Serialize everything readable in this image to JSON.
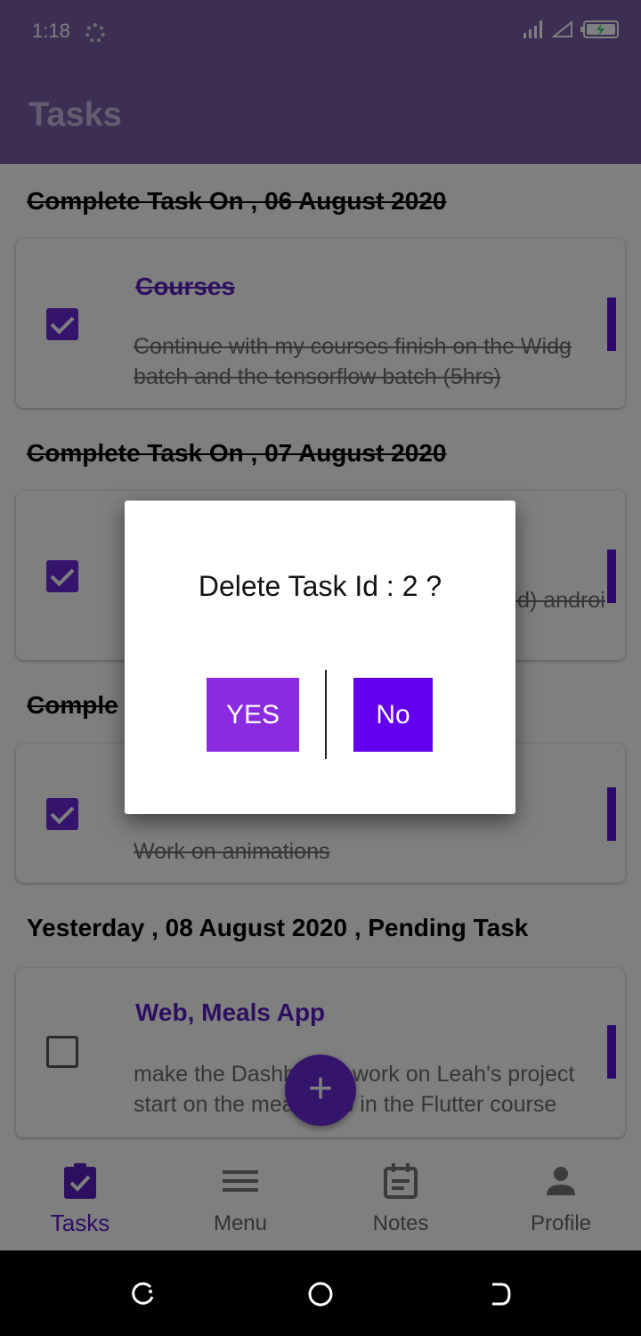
{
  "status_bar": {
    "time": "1:18"
  },
  "app_bar": {
    "title": "Tasks"
  },
  "sections": [
    {
      "title": "Complete Task On , 06 August 2020",
      "strike": true
    },
    {
      "title": "Complete Task On , 07 August 2020",
      "strike": true
    },
    {
      "title": "Comple",
      "strike": true
    },
    {
      "title": "Yesterday , 08 August 2020 , Pending Task",
      "strike": false
    }
  ],
  "tasks": [
    {
      "title": "Courses",
      "desc_line1": "Continue with my courses finish on the Widg",
      "desc_line2": "batch and the tensorflow batch (5hrs)",
      "checked": true
    },
    {
      "title": "",
      "desc_line1": "ild) androi",
      "desc_line2": "",
      "checked": true
    },
    {
      "title": "",
      "desc_line1": "",
      "desc_line2": "Work on animations",
      "checked": true
    },
    {
      "title": "Web, Meals App",
      "desc_line1": "make the Dashboard, work on Leah's project",
      "desc_line2": "start on the meals app in the Flutter course",
      "checked": false
    }
  ],
  "fab": {
    "label": "+"
  },
  "dialog": {
    "message": "Delete Task Id : 2 ?",
    "yes_label": "YES",
    "no_label": "No"
  },
  "bottom_nav": [
    {
      "label": "Tasks",
      "icon": "clipboard-check-icon",
      "active": true
    },
    {
      "label": "Menu",
      "icon": "menu-icon",
      "active": false
    },
    {
      "label": "Notes",
      "icon": "calendar-note-icon",
      "active": false
    },
    {
      "label": "Profile",
      "icon": "person-icon",
      "active": false
    }
  ],
  "colors": {
    "primary": "#6a2bd9",
    "app_bar": "#7b5fa8",
    "yes_button": "#8a2be2",
    "no_button": "#6200ee"
  }
}
